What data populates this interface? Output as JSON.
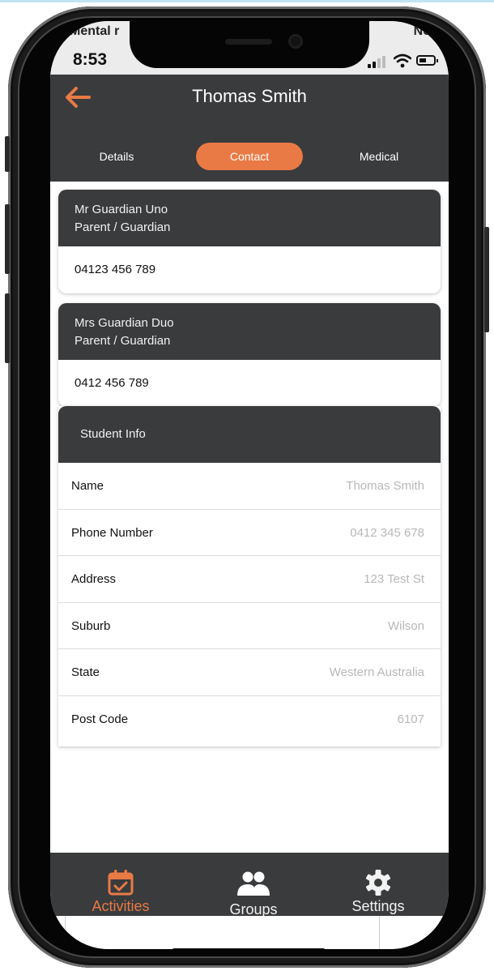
{
  "status_bar": {
    "carrier_left": "Mental r",
    "carrier_right": "No",
    "time": "8:53"
  },
  "header": {
    "title": "Thomas Smith",
    "back_icon": "arrow-left-icon"
  },
  "tabs": [
    {
      "label": "Details",
      "active": false
    },
    {
      "label": "Contact",
      "active": true
    },
    {
      "label": "Medical",
      "active": false
    }
  ],
  "guardians": [
    {
      "name": "Mr Guardian Uno",
      "role": "Parent / Guardian",
      "phone": "04123 456 789"
    },
    {
      "name": "Mrs Guardian Duo",
      "role": "Parent / Guardian",
      "phone": "0412 456 789"
    }
  ],
  "student_info": {
    "heading": "Student Info",
    "rows": [
      {
        "label": "Name",
        "value": "Thomas Smith"
      },
      {
        "label": "Phone Number",
        "value": "0412 345 678"
      },
      {
        "label": "Address",
        "value": "123 Test St"
      },
      {
        "label": "Suburb",
        "value": "Wilson"
      },
      {
        "label": "State",
        "value": "Western Australia"
      },
      {
        "label": "Post Code",
        "value": "6107"
      }
    ]
  },
  "bottom_nav": [
    {
      "label": "Activities",
      "icon": "calendar-check-icon",
      "active": true
    },
    {
      "label": "Groups",
      "icon": "users-icon",
      "active": false
    },
    {
      "label": "Settings",
      "icon": "gear-icon",
      "active": false
    }
  ],
  "colors": {
    "accent": "#e97a45",
    "header_bg": "#393b3d",
    "value_text": "#b8b8b8"
  }
}
